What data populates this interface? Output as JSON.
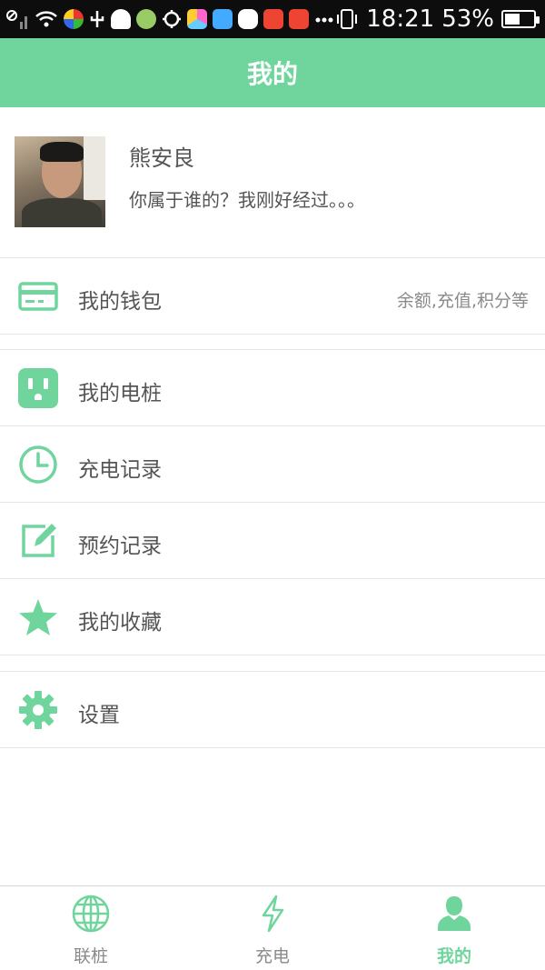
{
  "status_bar": {
    "time": "18:21",
    "battery_percent": "53%",
    "battery_level": 0.53
  },
  "header": {
    "title": "我的"
  },
  "profile": {
    "name": "熊安良",
    "bio": "你属于谁的？我刚好经过。。。"
  },
  "menu": {
    "wallet": {
      "label": "我的钱包",
      "hint": "余额,充值,积分等"
    },
    "piles": {
      "label": "我的电桩"
    },
    "charge_records": {
      "label": "充电记录"
    },
    "reservation_records": {
      "label": "预约记录"
    },
    "favorites": {
      "label": "我的收藏"
    },
    "settings": {
      "label": "设置"
    }
  },
  "tabs": {
    "items": [
      {
        "label": "联桩",
        "icon": "globe-icon"
      },
      {
        "label": "充电",
        "icon": "lightning-icon"
      },
      {
        "label": "我的",
        "icon": "person-icon"
      }
    ],
    "active_index": 2
  },
  "colors": {
    "accent": "#6fd59d",
    "text": "#555555",
    "muted": "#8a8a8a",
    "divider": "#e6e6e6"
  }
}
